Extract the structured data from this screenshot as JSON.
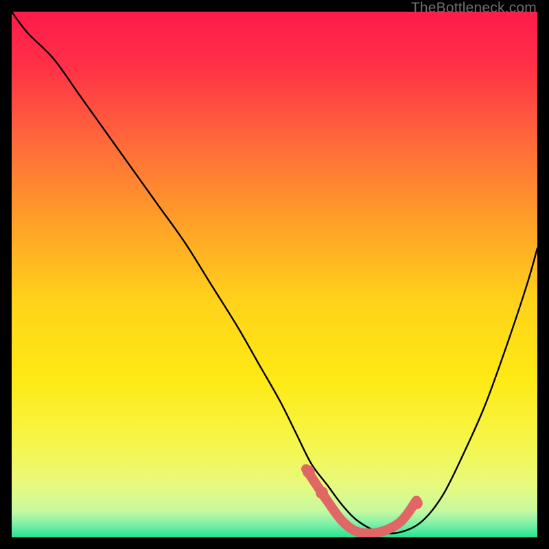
{
  "watermark": "TheBottleneck.com",
  "colors": {
    "background": "#000000",
    "gradient_stops": [
      {
        "offset": 0.0,
        "color": "#ff1b4a"
      },
      {
        "offset": 0.1,
        "color": "#ff2f47"
      },
      {
        "offset": 0.25,
        "color": "#ff6a3a"
      },
      {
        "offset": 0.4,
        "color": "#ffa028"
      },
      {
        "offset": 0.55,
        "color": "#ffd21a"
      },
      {
        "offset": 0.7,
        "color": "#feea14"
      },
      {
        "offset": 0.82,
        "color": "#f6f64a"
      },
      {
        "offset": 0.9,
        "color": "#e8fa7d"
      },
      {
        "offset": 0.95,
        "color": "#c6f9a0"
      },
      {
        "offset": 0.975,
        "color": "#7df0a7"
      },
      {
        "offset": 1.0,
        "color": "#24e58f"
      }
    ],
    "curve": "#000000",
    "highlight": "#e16666"
  },
  "chart_data": {
    "type": "line",
    "title": "",
    "xlabel": "",
    "ylabel": "",
    "xlim": [
      0,
      100
    ],
    "ylim": [
      0,
      100
    ],
    "series": [
      {
        "name": "bottleneck-curve",
        "x": [
          0,
          3,
          8,
          13,
          18,
          23,
          28,
          33,
          38,
          43,
          47,
          51,
          54,
          57,
          60,
          63,
          66,
          70,
          74,
          78,
          82,
          86,
          90,
          94,
          98,
          100
        ],
        "y": [
          100,
          96,
          91,
          84,
          77,
          70,
          63,
          56,
          48,
          40,
          33,
          26,
          20,
          14,
          10,
          6,
          3,
          1,
          1,
          3,
          8,
          16,
          25,
          36,
          48,
          55
        ]
      }
    ],
    "highlight_segment": {
      "x": [
        56,
        60,
        63,
        66,
        70,
        74,
        77
      ],
      "y": [
        13,
        7,
        3,
        1,
        1,
        3,
        7
      ]
    },
    "highlight_dots": {
      "x": [
        56.5,
        59,
        77
      ],
      "y": [
        12.5,
        8.5,
        6.5
      ]
    }
  }
}
